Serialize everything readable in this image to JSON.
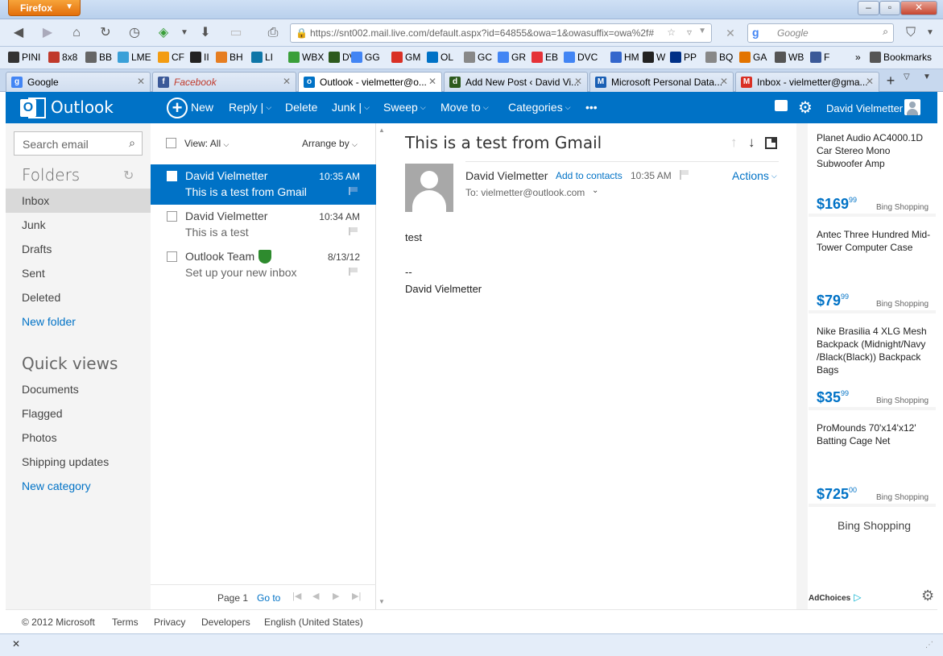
{
  "browser": {
    "app_button": "Firefox",
    "url": "https://snt002.mail.live.com/default.aspx?id=64855&owa=1&owasuffix=owa%2f#",
    "url_domain": "live.com",
    "search_placeholder": "Google",
    "bookmarks": [
      {
        "label": "PINI",
        "color": "#333333"
      },
      {
        "label": "8x8",
        "color": "#c0392b"
      },
      {
        "label": "BB",
        "color": "#666666"
      },
      {
        "label": "LME",
        "color": "#3aa0d8"
      },
      {
        "label": "CF",
        "color": "#f39c12"
      },
      {
        "label": "II",
        "color": "#222222"
      },
      {
        "label": "BH",
        "color": "#e67e22"
      },
      {
        "label": "LI",
        "color": "#0e76a8"
      },
      {
        "label": "WBX",
        "color": "#3a9f3a"
      },
      {
        "label": "DV",
        "color": "#2d5a1e"
      },
      {
        "label": "GG",
        "color": "#4285f4"
      },
      {
        "label": "GM",
        "color": "#d93025"
      },
      {
        "label": "OL",
        "color": "#0072c6"
      },
      {
        "label": "GC",
        "color": "#888888"
      },
      {
        "label": "GR",
        "color": "#4285f4"
      },
      {
        "label": "EB",
        "color": "#e53238"
      },
      {
        "label": "DVC",
        "color": "#4285f4"
      },
      {
        "label": "HM",
        "color": "#3366cc"
      },
      {
        "label": "W",
        "color": "#222222"
      },
      {
        "label": "PP",
        "color": "#003087"
      },
      {
        "label": "BQ",
        "color": "#888888"
      },
      {
        "label": "GA",
        "color": "#e37400"
      },
      {
        "label": "WB",
        "color": "#555555"
      },
      {
        "label": "F",
        "color": "#3b5998"
      }
    ],
    "bookmarks_more": "»",
    "bookmarks_label": "Bookmarks",
    "tabs": [
      {
        "label": "Google",
        "fav": "g",
        "fav_color": "#4285f4"
      },
      {
        "label": "Facebook",
        "fav": "f",
        "fav_color": "#3b5998"
      },
      {
        "label": "Outlook - vielmetter@o...",
        "fav": "o",
        "fav_color": "#0072c6"
      },
      {
        "label": "Add New Post ‹ David Vi...",
        "fav": "d",
        "fav_color": "#2d5a1e"
      },
      {
        "label": "Microsoft Personal Data...",
        "fav": "M",
        "fav_color": "#1a5fb4"
      },
      {
        "label": "Inbox - vielmetter@gma...",
        "fav": "M",
        "fav_color": "#d93025"
      }
    ]
  },
  "header": {
    "brand": "Outlook",
    "commands": {
      "new": "New",
      "reply": "Reply",
      "delete": "Delete",
      "junk": "Junk",
      "sweep": "Sweep",
      "move_to": "Move to",
      "categories": "Categories",
      "more": "•••"
    },
    "user_name": "David Vielmetter"
  },
  "sidebar": {
    "search_placeholder": "Search email",
    "folders_heading": "Folders",
    "folders": [
      "Inbox",
      "Junk",
      "Drafts",
      "Sent",
      "Deleted"
    ],
    "new_folder": "New folder",
    "quick_views_heading": "Quick views",
    "quick_views": [
      "Documents",
      "Flagged",
      "Photos",
      "Shipping updates"
    ],
    "new_category": "New category"
  },
  "message_list": {
    "view_label": "View: All",
    "arrange_label": "Arrange by",
    "messages": [
      {
        "from": "David Vielmetter",
        "subject": "This is a test from Gmail",
        "time": "10:35 AM"
      },
      {
        "from": "David Vielmetter",
        "subject": "This is a test",
        "time": "10:34 AM"
      },
      {
        "from": "Outlook Team",
        "subject": "Set up your new inbox",
        "time": "8/13/12"
      }
    ],
    "page_label": "Page 1",
    "goto_label": "Go to"
  },
  "reading_pane": {
    "subject": "This is a test from Gmail",
    "from": "David Vielmetter",
    "add_to_contacts": "Add to contacts",
    "time": "10:35 AM",
    "actions": "Actions",
    "to": "To: vielmetter@outlook.com",
    "body": [
      "test",
      "--",
      "David Vielmetter"
    ]
  },
  "ads": {
    "items": [
      {
        "title": "Planet Audio AC4000.1D Car Stereo Mono Subwoofer Amp",
        "price": "$169",
        "cents": "99",
        "source": "Bing Shopping"
      },
      {
        "title": "Antec Three Hundred Mid-Tower Computer Case",
        "price": "$79",
        "cents": "99",
        "source": "Bing Shopping"
      },
      {
        "title": "Nike Brasilia 4 XLG Mesh Backpack (Midnight/Navy /Black(Black)) Backpack Bags",
        "price": "$35",
        "cents": "99",
        "source": "Bing Shopping"
      },
      {
        "title": "ProMounds 70'x14'x12' Batting Cage Net",
        "price": "$725",
        "cents": "00",
        "source": "Bing Shopping"
      }
    ],
    "footer_title": "Bing Shopping",
    "adchoices": "AdChoices"
  },
  "footer": {
    "copyright": "© 2012 Microsoft",
    "links": [
      "Terms",
      "Privacy",
      "Developers",
      "English (United States)"
    ]
  },
  "colors": {
    "accent": "#0072c6",
    "selected_folder": "#d9d9d9",
    "pane_bg": "#f4f4f4"
  }
}
